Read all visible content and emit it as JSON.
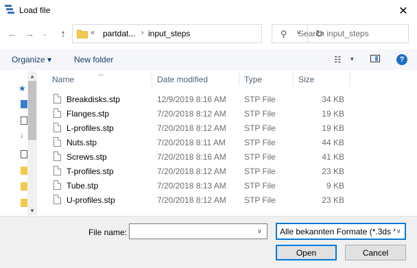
{
  "window": {
    "title": "Load file",
    "icon": "load-file-icon",
    "close_label": "✕"
  },
  "address": {
    "overflow": "«",
    "crumbs": [
      "partdat...",
      "input_steps"
    ],
    "separator": "›"
  },
  "search": {
    "placeholder": "Search input_steps"
  },
  "toolbar": {
    "organize_label": "Organize ▾",
    "new_folder_label": "New folder",
    "view_icon": "☷",
    "view_caret": "▾",
    "help_label": "?"
  },
  "columns": {
    "name": "Name",
    "date": "Date modified",
    "type": "Type",
    "size": "Size"
  },
  "files": [
    {
      "name": "Breakdisks.stp",
      "date": "12/9/2019 8:16 AM",
      "type": "STP File",
      "size": "34 KB"
    },
    {
      "name": "Flanges.stp",
      "date": "7/20/2018 8:12 AM",
      "type": "STP File",
      "size": "19 KB"
    },
    {
      "name": "L-profiles.stp",
      "date": "7/20/2018 8:12 AM",
      "type": "STP File",
      "size": "19 KB"
    },
    {
      "name": "Nuts.stp",
      "date": "7/20/2018 8:11 AM",
      "type": "STP File",
      "size": "44 KB"
    },
    {
      "name": "Screws.stp",
      "date": "7/20/2018 8:16 AM",
      "type": "STP File",
      "size": "41 KB"
    },
    {
      "name": "T-profiles.stp",
      "date": "7/20/2018 8:12 AM",
      "type": "STP File",
      "size": "23 KB"
    },
    {
      "name": "Tube.stp",
      "date": "7/20/2018 8:13 AM",
      "type": "STP File",
      "size": "9 KB"
    },
    {
      "name": "U-profiles.stp",
      "date": "7/20/2018 8:12 AM",
      "type": "STP File",
      "size": "23 KB"
    }
  ],
  "footer": {
    "filename_label": "File name:",
    "filename_value": "",
    "filter_value": "Alle bekannten Formate (*.3ds *",
    "open_label": "Open",
    "cancel_label": "Cancel"
  },
  "colors": {
    "accent": "#0078d7",
    "toolbar_bg": "#f4f6f9",
    "footer_bg": "#f0f0f0",
    "link_text": "#1a3c6e",
    "secondary_text": "#6d6d6d"
  }
}
